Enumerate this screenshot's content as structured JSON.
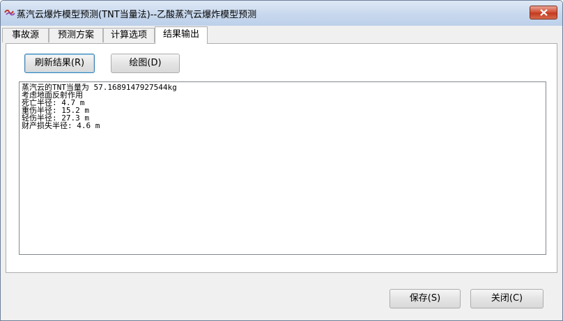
{
  "window": {
    "title": "蒸汽云爆炸模型预测(TNT当量法)--乙酸蒸汽云爆炸模型预测"
  },
  "tabs": [
    {
      "label": "事故源"
    },
    {
      "label": "预测方案"
    },
    {
      "label": "计算选项"
    },
    {
      "label": "结果输出"
    }
  ],
  "toolbar": {
    "refresh_label": "刷新结果(R)",
    "plot_label": "绘图(D)"
  },
  "results": {
    "lines": [
      "蒸汽云的TNT当量为 57.1689147927544kg",
      "考虑地面反射作用",
      "死亡半径: 4.7 m",
      "重伤半径: 15.2 m",
      "轻伤半径: 27.3 m",
      "财产损失半径: 4.6 m"
    ]
  },
  "footer": {
    "save_label": "保存(S)",
    "close_label": "关闭(C)"
  }
}
